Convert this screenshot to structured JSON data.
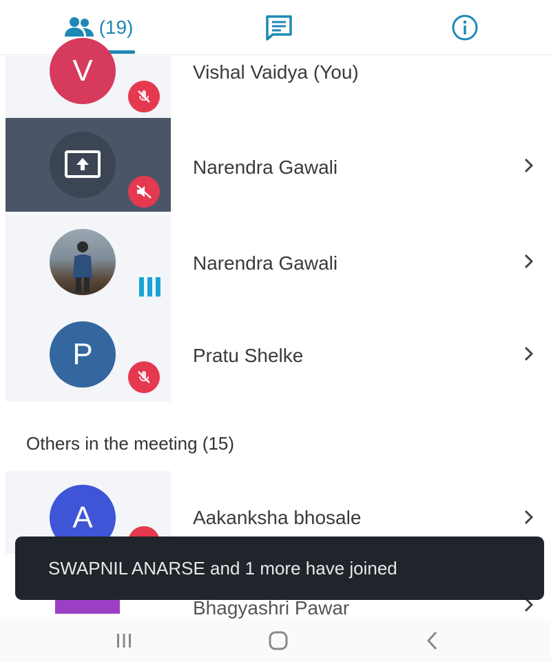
{
  "tabs": {
    "participants_count": "(19)",
    "active": "participants"
  },
  "participants": [
    {
      "initial": "V",
      "name": "Vishal Vaidya (You)",
      "avatar_color": "#d63a5d",
      "status": "muted"
    },
    {
      "initial": "",
      "name": "Narendra Gawali",
      "avatar_color": "#3b4554",
      "status": "muted-speaker",
      "screen_share": true
    },
    {
      "initial": "",
      "name": "Narendra Gawali",
      "avatar_color": "#7c8b98",
      "status": "speaking"
    },
    {
      "initial": "P",
      "name": "Pratu Shelke",
      "avatar_color": "#3467a0",
      "status": "muted"
    }
  ],
  "others": {
    "title": "Others in the meeting (15)",
    "items": [
      {
        "initial": "A",
        "name": "Aakanksha bhosale",
        "avatar_color": "#3f55d8",
        "status": "muted"
      },
      {
        "initial": "",
        "name": "Bhagyashri Pawar",
        "avatar_color": "#9b3fc4"
      }
    ]
  },
  "toast": {
    "message": "SWAPNIL ANARSE and 1 more have joined"
  },
  "colors": {
    "accent": "#1e88b4",
    "mute_red": "#e53950",
    "toast_bg": "#20242b"
  },
  "icons": [
    "people-icon",
    "chat-icon",
    "info-icon",
    "mic-off-icon",
    "speaker-off-icon",
    "screen-share-icon",
    "audio-level-icon",
    "chevron-right-icon",
    "nav-recents-icon",
    "nav-home-icon",
    "nav-back-icon"
  ]
}
